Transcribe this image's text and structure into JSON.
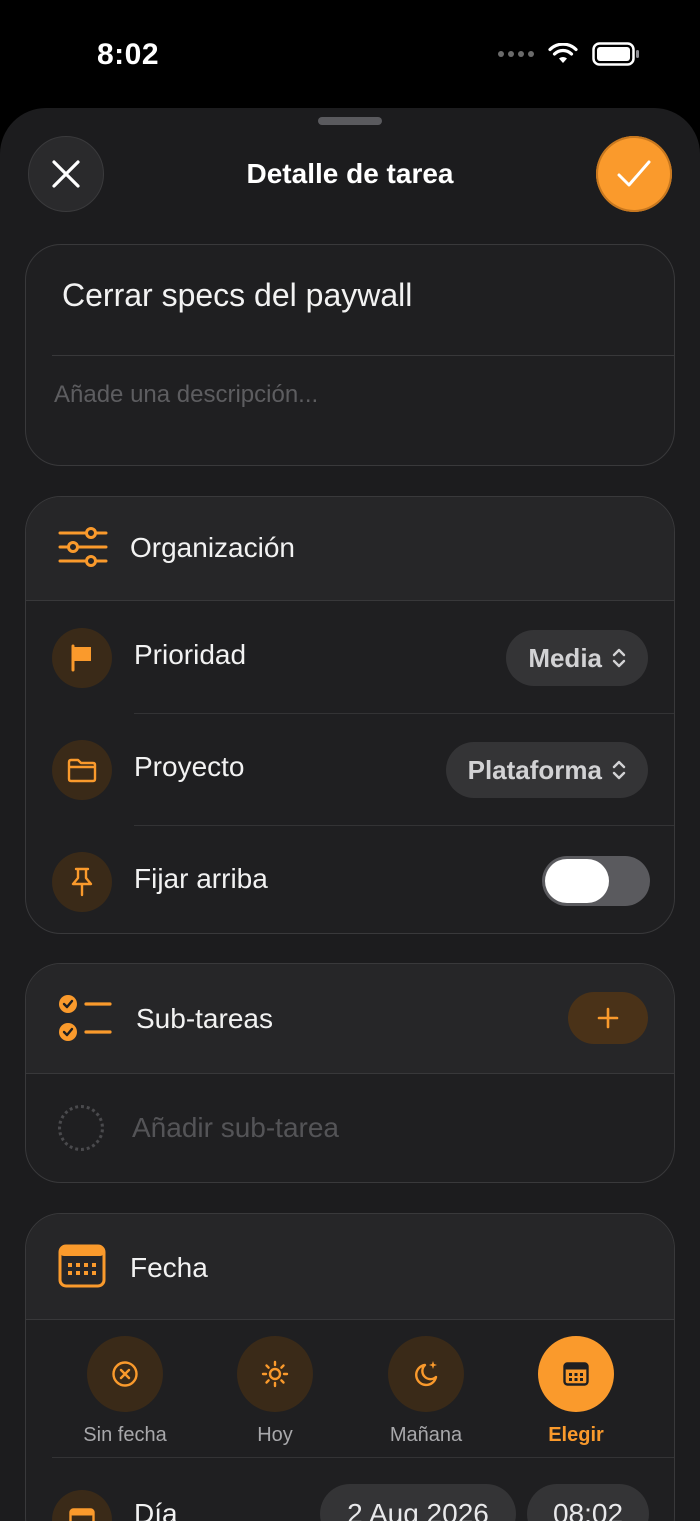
{
  "status": {
    "time": "8:02"
  },
  "sheet": {
    "title": "Detalle de tarea"
  },
  "task": {
    "title": "Cerrar specs del paywall",
    "description_placeholder": "Añade una descripción..."
  },
  "organization": {
    "header": "Organización",
    "priority": {
      "label": "Prioridad",
      "value": "Media"
    },
    "project": {
      "label": "Proyecto",
      "value": "Plataforma"
    },
    "pin": {
      "label": "Fijar arriba",
      "enabled": false
    }
  },
  "subtasks": {
    "header": "Sub-tareas",
    "add_placeholder": "Añadir sub-tarea"
  },
  "date": {
    "header": "Fecha",
    "options": [
      {
        "label": "Sin fecha",
        "icon": "x-circle-icon"
      },
      {
        "label": "Hoy",
        "icon": "sun-icon"
      },
      {
        "label": "Mañana",
        "icon": "moon-stars-icon"
      },
      {
        "label": "Elegir",
        "icon": "calendar-icon",
        "selected": true
      }
    ],
    "day": {
      "label": "Día",
      "date": "2 Aug 2026",
      "time": "08:02"
    }
  },
  "colors": {
    "accent": "#fa9a2c",
    "sheet_bg": "#1c1c1e",
    "card_bg": "#1f1f21"
  }
}
